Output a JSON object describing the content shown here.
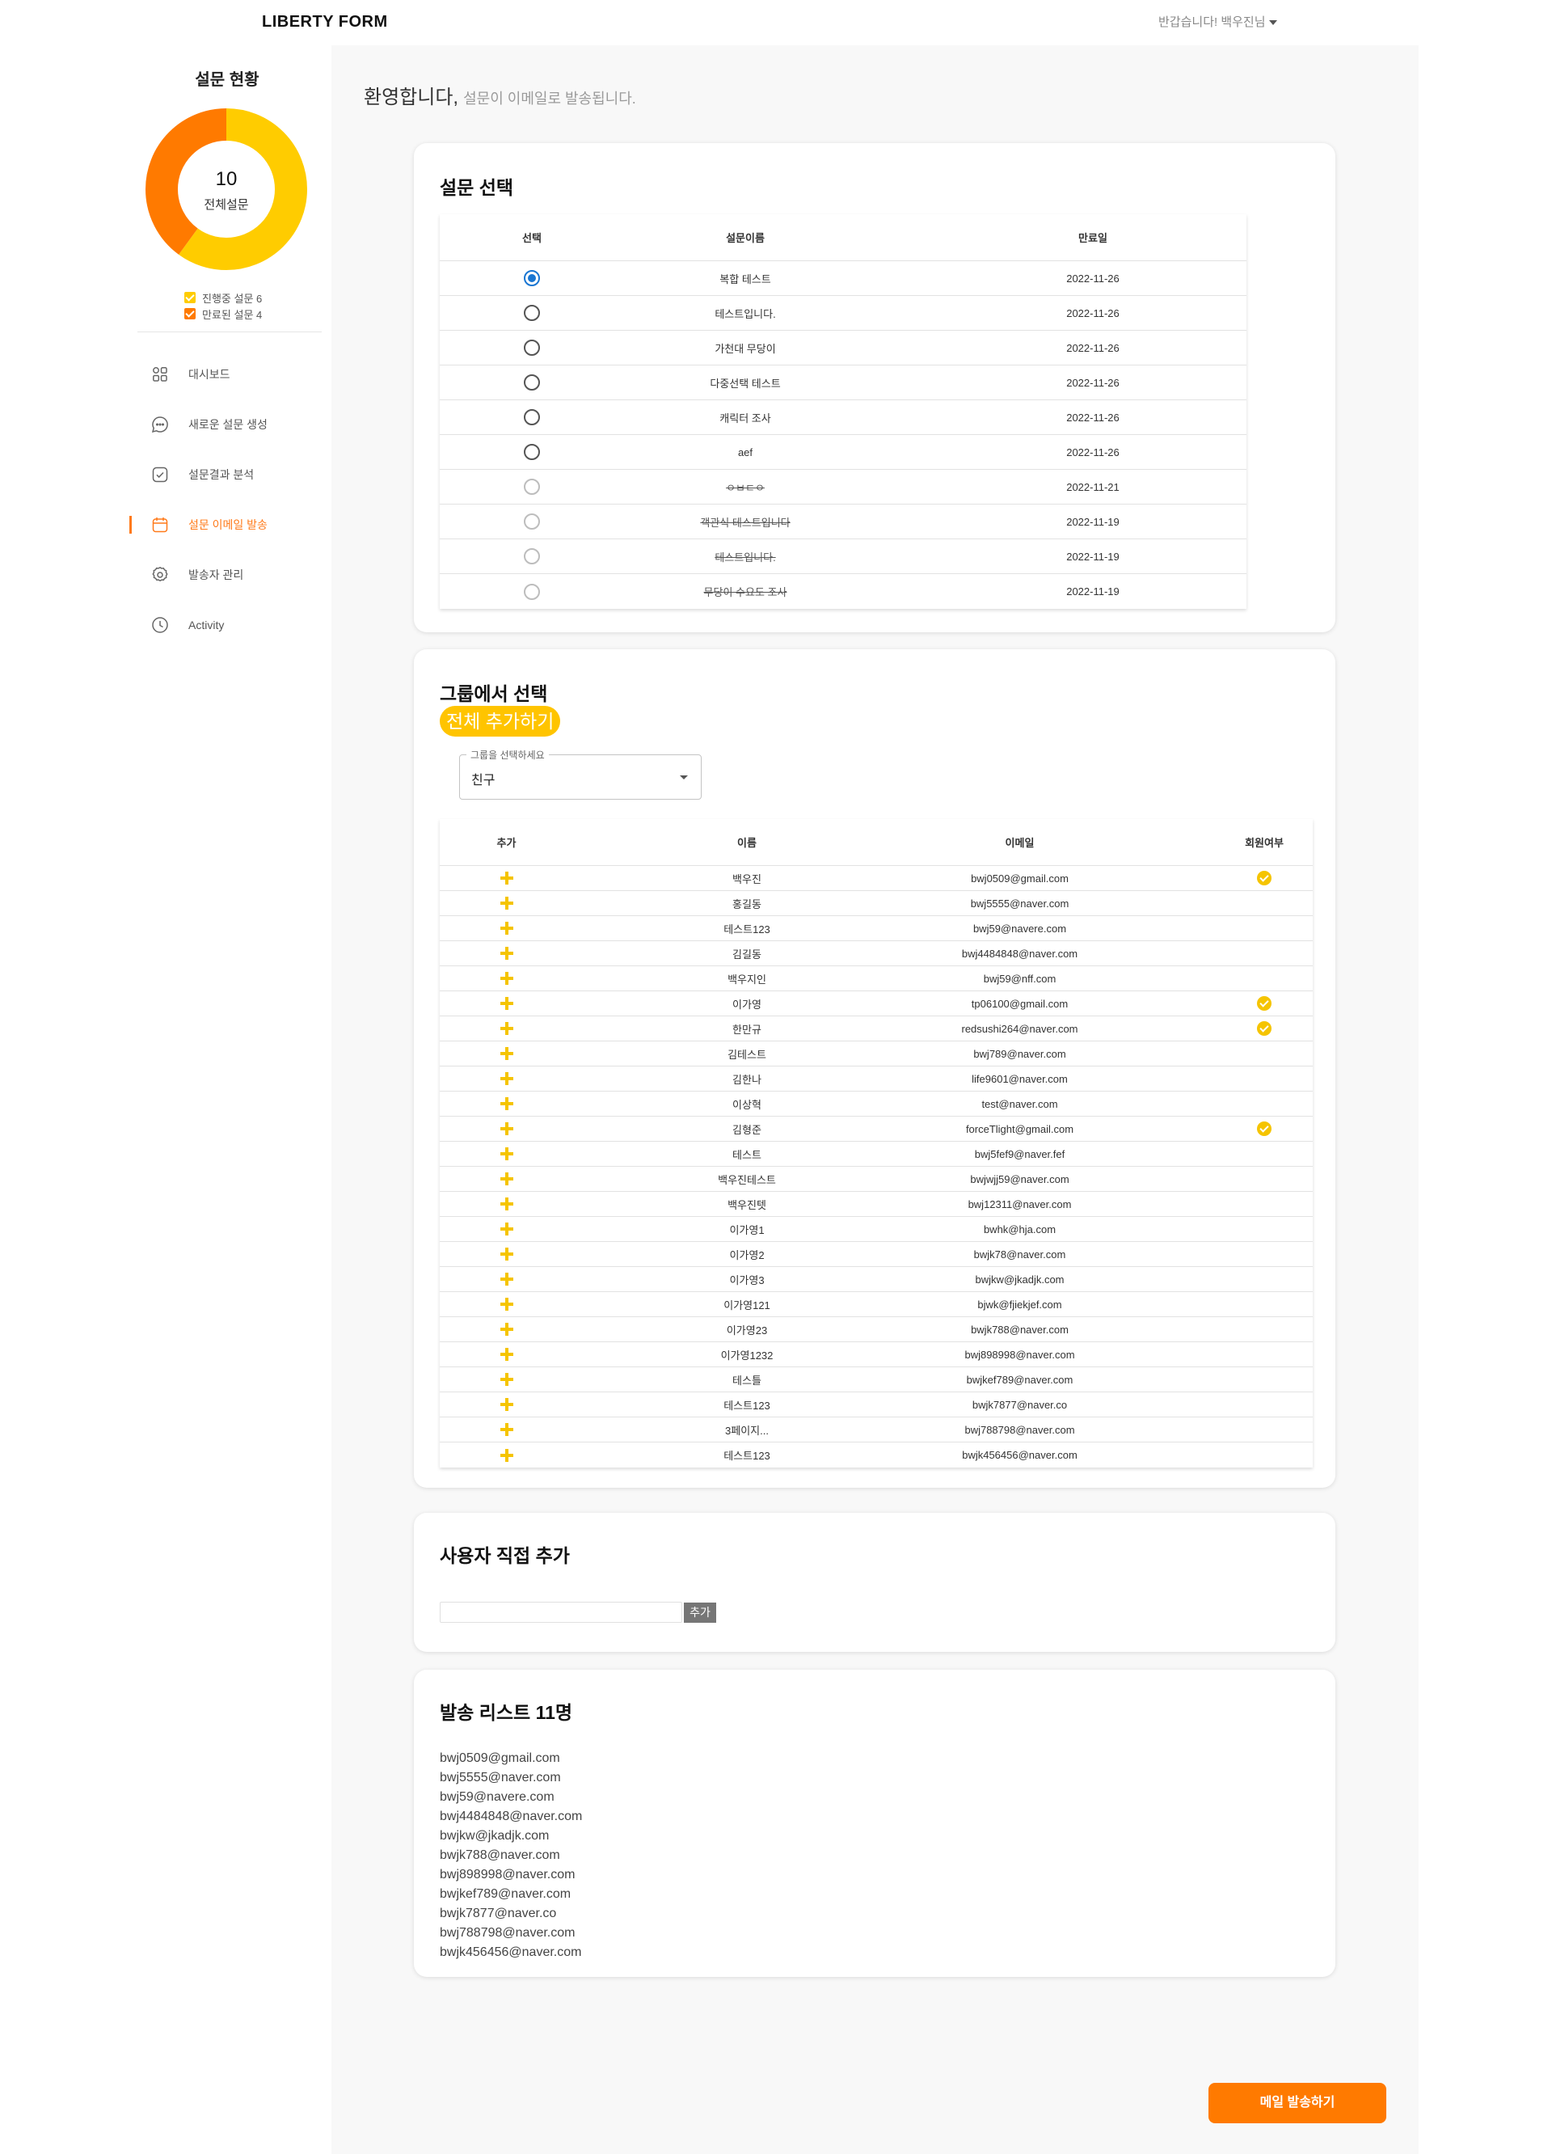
{
  "header": {
    "logo": "LIBERTY FORM",
    "greeting": "반갑습니다! 백우진님"
  },
  "sidebar": {
    "title": "설문 현황",
    "total_count": "10",
    "total_label": "전체설문",
    "chart_data": {
      "type": "pie",
      "series": [
        {
          "name": "진행중 설문",
          "value": 6,
          "color": "#FFCC00"
        },
        {
          "name": "만료된 설문",
          "value": 4,
          "color": "#FF7A00"
        }
      ]
    },
    "legend": [
      {
        "label": "진행중 설문 6",
        "color": "#FFCC00"
      },
      {
        "label": "만료된 설문 4",
        "color": "#FF7A00"
      }
    ],
    "nav": [
      {
        "label": "대시보드",
        "icon": "dashboard-grid-icon",
        "active": false
      },
      {
        "label": "새로운 설문 생성",
        "icon": "chat-bubble-icon",
        "active": false
      },
      {
        "label": "설문결과 분석",
        "icon": "check-square-icon",
        "active": false
      },
      {
        "label": "설문 이메일 발송",
        "icon": "calendar-icon",
        "active": true
      },
      {
        "label": "발송자 관리",
        "icon": "gear-icon",
        "active": false
      },
      {
        "label": "Activity",
        "icon": "clock-icon",
        "active": false
      }
    ]
  },
  "welcome": {
    "big": "환영합니다,",
    "small": "설문이 이메일로 발송됩니다."
  },
  "survey_select": {
    "title": "설문 선택",
    "columns": [
      "선택",
      "설문이름",
      "만료일"
    ],
    "rows": [
      {
        "name": "복합 테스트",
        "date": "2022-11-26",
        "selected": true,
        "expired": false
      },
      {
        "name": "테스트입니다.",
        "date": "2022-11-26",
        "selected": false,
        "expired": false
      },
      {
        "name": "가천대 무당이",
        "date": "2022-11-26",
        "selected": false,
        "expired": false
      },
      {
        "name": "다중선택 테스트",
        "date": "2022-11-26",
        "selected": false,
        "expired": false
      },
      {
        "name": "캐릭터 조사",
        "date": "2022-11-26",
        "selected": false,
        "expired": false
      },
      {
        "name": "aef",
        "date": "2022-11-26",
        "selected": false,
        "expired": false
      },
      {
        "name": "ㅇㅂㄷㅇ",
        "date": "2022-11-21",
        "selected": false,
        "expired": true
      },
      {
        "name": "객관식 테스트입니다",
        "date": "2022-11-19",
        "selected": false,
        "expired": true
      },
      {
        "name": "테스트입니다.",
        "date": "2022-11-19",
        "selected": false,
        "expired": true
      },
      {
        "name": "무당이 수요도 조사",
        "date": "2022-11-19",
        "selected": false,
        "expired": true
      }
    ]
  },
  "group_select": {
    "title": "그룹에서 선택",
    "add_all": "전체 추가하기",
    "select_label": "그룹을 선택하세요",
    "select_value": "친구",
    "columns": [
      "추가",
      "이름",
      "이메일",
      "회원여부"
    ],
    "rows": [
      {
        "name": "백우진",
        "email": "bwj0509@gmail.com",
        "member": true
      },
      {
        "name": "홍길동",
        "email": "bwj5555@naver.com",
        "member": false
      },
      {
        "name": "테스트123",
        "email": "bwj59@navere.com",
        "member": false
      },
      {
        "name": "김길동",
        "email": "bwj4484848@naver.com",
        "member": false
      },
      {
        "name": "백우지인",
        "email": "bwj59@nff.com",
        "member": false
      },
      {
        "name": "이가영",
        "email": "tp06100@gmail.com",
        "member": true
      },
      {
        "name": "한만규",
        "email": "redsushi264@naver.com",
        "member": true
      },
      {
        "name": "김테스트",
        "email": "bwj789@naver.com",
        "member": false
      },
      {
        "name": "김한나",
        "email": "life9601@naver.com",
        "member": false
      },
      {
        "name": "이상혁",
        "email": "test@naver.com",
        "member": false
      },
      {
        "name": "김형준",
        "email": "forceTlight@gmail.com",
        "member": true
      },
      {
        "name": "테스트",
        "email": "bwj5fef9@naver.fef",
        "member": false
      },
      {
        "name": "백우진테스트",
        "email": "bwjwjj59@naver.com",
        "member": false
      },
      {
        "name": "백우진텟",
        "email": "bwj12311@naver.com",
        "member": false
      },
      {
        "name": "이가영1",
        "email": "bwhk@hja.com",
        "member": false
      },
      {
        "name": "이가영2",
        "email": "bwjk78@naver.com",
        "member": false
      },
      {
        "name": "이가영3",
        "email": "bwjkw@jkadjk.com",
        "member": false
      },
      {
        "name": "이가영121",
        "email": "bjwk@fjiekjef.com",
        "member": false
      },
      {
        "name": "이가영23",
        "email": "bwjk788@naver.com",
        "member": false
      },
      {
        "name": "이가영1232",
        "email": "bwj898998@naver.com",
        "member": false
      },
      {
        "name": "테스틀",
        "email": "bwjkef789@naver.com",
        "member": false
      },
      {
        "name": "테스트123",
        "email": "bwjk7877@naver.co",
        "member": false
      },
      {
        "name": "3페이지...",
        "email": "bwj788798@naver.com",
        "member": false
      },
      {
        "name": "테스트123",
        "email": "bwjk456456@naver.com",
        "member": false
      }
    ]
  },
  "direct_add": {
    "title": "사용자 직접 추가",
    "input_value": "",
    "button": "추가"
  },
  "send_list": {
    "title": "발송 리스트 11명",
    "emails": [
      "bwj0509@gmail.com",
      "bwj5555@naver.com",
      "bwj59@navere.com",
      "bwj4484848@naver.com",
      "bwjkw@jkadjk.com",
      "bwjk788@naver.com",
      "bwj898998@naver.com",
      "bwjkef789@naver.com",
      "bwjk7877@naver.co",
      "bwj788798@naver.com",
      "bwjk456456@naver.com"
    ]
  },
  "send_button": "메일 발송하기"
}
